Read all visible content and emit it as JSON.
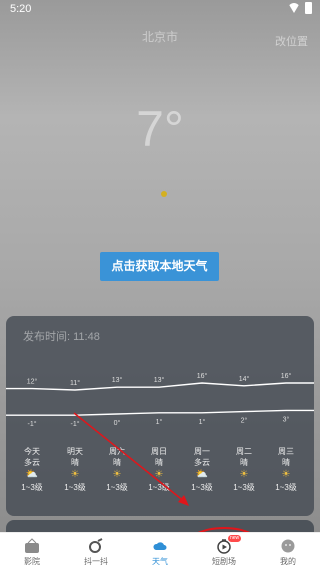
{
  "status": {
    "time": "5:20"
  },
  "header": {
    "city": "北京市",
    "change_city": "改位置"
  },
  "current": {
    "temperature": "7°"
  },
  "action": {
    "get_local_weather": "点击获取本地天气"
  },
  "forecast": {
    "publish_time": "发布时间: 11:48",
    "days": [
      {
        "day": "今天",
        "cond": "多云",
        "icon": "partly-cloudy-icon",
        "wind": "1~3级",
        "high": 12,
        "low": -1
      },
      {
        "day": "明天",
        "cond": "晴",
        "icon": "sun-icon",
        "wind": "1~3级",
        "high": 11,
        "low": -1
      },
      {
        "day": "周六",
        "cond": "晴",
        "icon": "sun-icon",
        "wind": "1~3级",
        "high": 13,
        "low": 0
      },
      {
        "day": "周日",
        "cond": "晴",
        "icon": "sun-icon",
        "wind": "1~3级",
        "high": 13,
        "low": 1
      },
      {
        "day": "周一",
        "cond": "多云",
        "icon": "partly-cloudy-icon",
        "wind": "1~3级",
        "high": 16,
        "low": 1
      },
      {
        "day": "周二",
        "cond": "晴",
        "icon": "sun-icon",
        "wind": "1~3级",
        "high": 14,
        "low": 2
      },
      {
        "day": "周三",
        "cond": "晴",
        "icon": "sun-icon",
        "wind": "1~3级",
        "high": 16,
        "low": 3
      }
    ]
  },
  "tabs": [
    {
      "label": "影院",
      "icon": "cinema-icon"
    },
    {
      "label": "抖一抖",
      "icon": "shake-icon"
    },
    {
      "label": "天气",
      "icon": "weather-icon",
      "active": true
    },
    {
      "label": "短剧场",
      "icon": "short-drama-icon",
      "badge": "new"
    },
    {
      "label": "我的",
      "icon": "profile-icon"
    }
  ],
  "colors": {
    "accent": "#2f8fd6",
    "button": "#3a93d7",
    "annotation": "#e0161b"
  }
}
